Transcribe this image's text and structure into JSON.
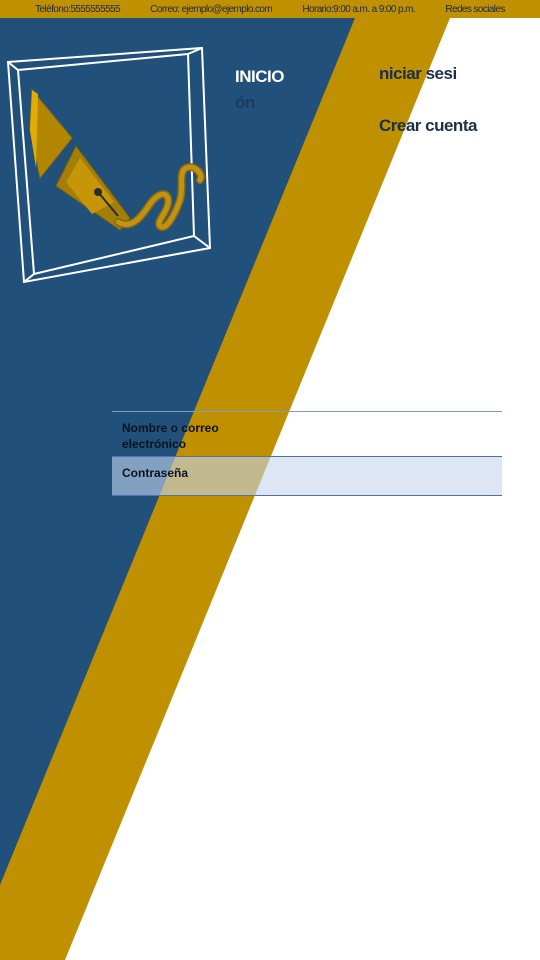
{
  "topbar": {
    "phone": "Teléfono:5555555555",
    "email": "Correo: ejemplo@ejemplo.com",
    "hours": "Horario:9:00 a.m. a 9:00 p.m.",
    "social": "Redes sociales"
  },
  "nav": {
    "home_main": "INICIO",
    "home_tail": "ón",
    "login": "niciar sesi",
    "signup": "Crear cuenta"
  },
  "form": {
    "user_label": "Nombre o correo electrónico",
    "user_value": "",
    "password_label": "Contraseña",
    "password_value": ""
  },
  "colors": {
    "navy": "#21507b",
    "gold": "#bf9000",
    "white": "#ffffff",
    "row_highlight": "#dae3f3"
  },
  "icons": {
    "logo": "fountain-pen-icon"
  }
}
